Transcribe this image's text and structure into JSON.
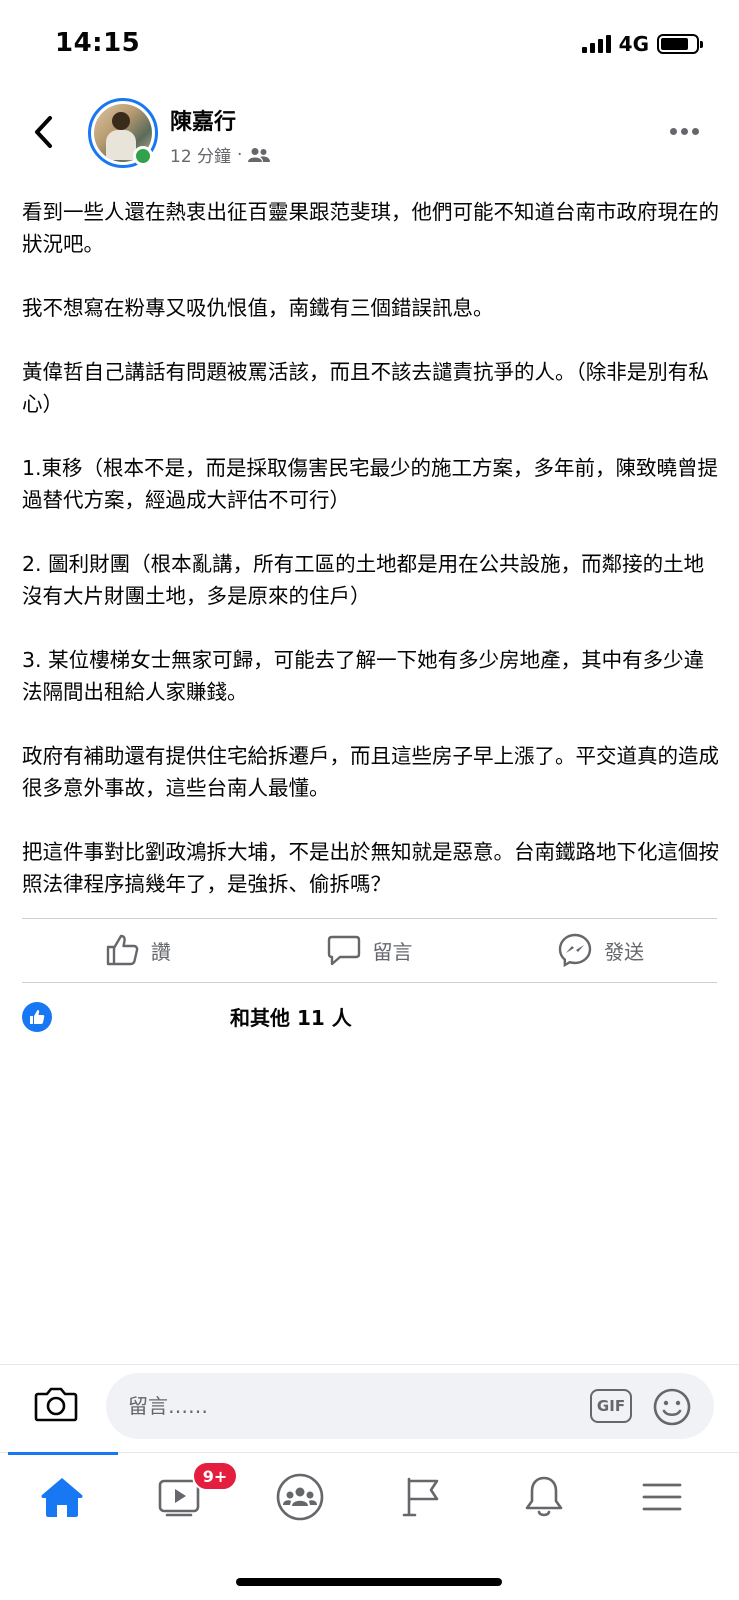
{
  "status_bar": {
    "time": "14:15",
    "network": "4G"
  },
  "post": {
    "author": "陳嘉行",
    "timestamp": "12 分鐘",
    "meta_separator": "·",
    "audience_icon": "friends-icon",
    "paragraphs": [
      "看到一些人還在熱衷出征百靈果跟范斐琪，他們可能不知道台南市政府現在的狀況吧。",
      "我不想寫在粉專又吸仇恨值，南鐵有三個錯誤訊息。",
      "黃偉哲自己講話有問題被罵活該，而且不該去譴責抗爭的人。（除非是別有私心）",
      "1.東移（根本不是，而是採取傷害民宅最少的施工方案，多年前，陳致曉曾提過替代方案，經過成大評估不可行）",
      "2. 圖利財團（根本亂講，所有工區的土地都是用在公共設施，而鄰接的土地沒有大片財團土地，多是原來的住戶）",
      "3. 某位樓梯女士無家可歸，可能去了解一下她有多少房地產，其中有多少違法隔間出租給人家賺錢。",
      "政府有補助還有提供住宅給拆遷戶，而且這些房子早上漲了。平交道真的造成很多意外事故，這些台南人最懂。",
      "把這件事對比劉政鴻拆大埔，不是出於無知就是惡意。台南鐵路地下化這個按照法律程序搞幾年了，是強拆、偷拆嗎？"
    ]
  },
  "actions": {
    "like_label": "讚",
    "comment_label": "留言",
    "send_label": "發送"
  },
  "reactions": {
    "summary": "和其他 11 人"
  },
  "comment_bar": {
    "placeholder": "留言……",
    "gif_label": "GIF"
  },
  "tab_bar": {
    "video_badge": "9+",
    "active_tab": "home",
    "accent_color": "#1877f2"
  }
}
